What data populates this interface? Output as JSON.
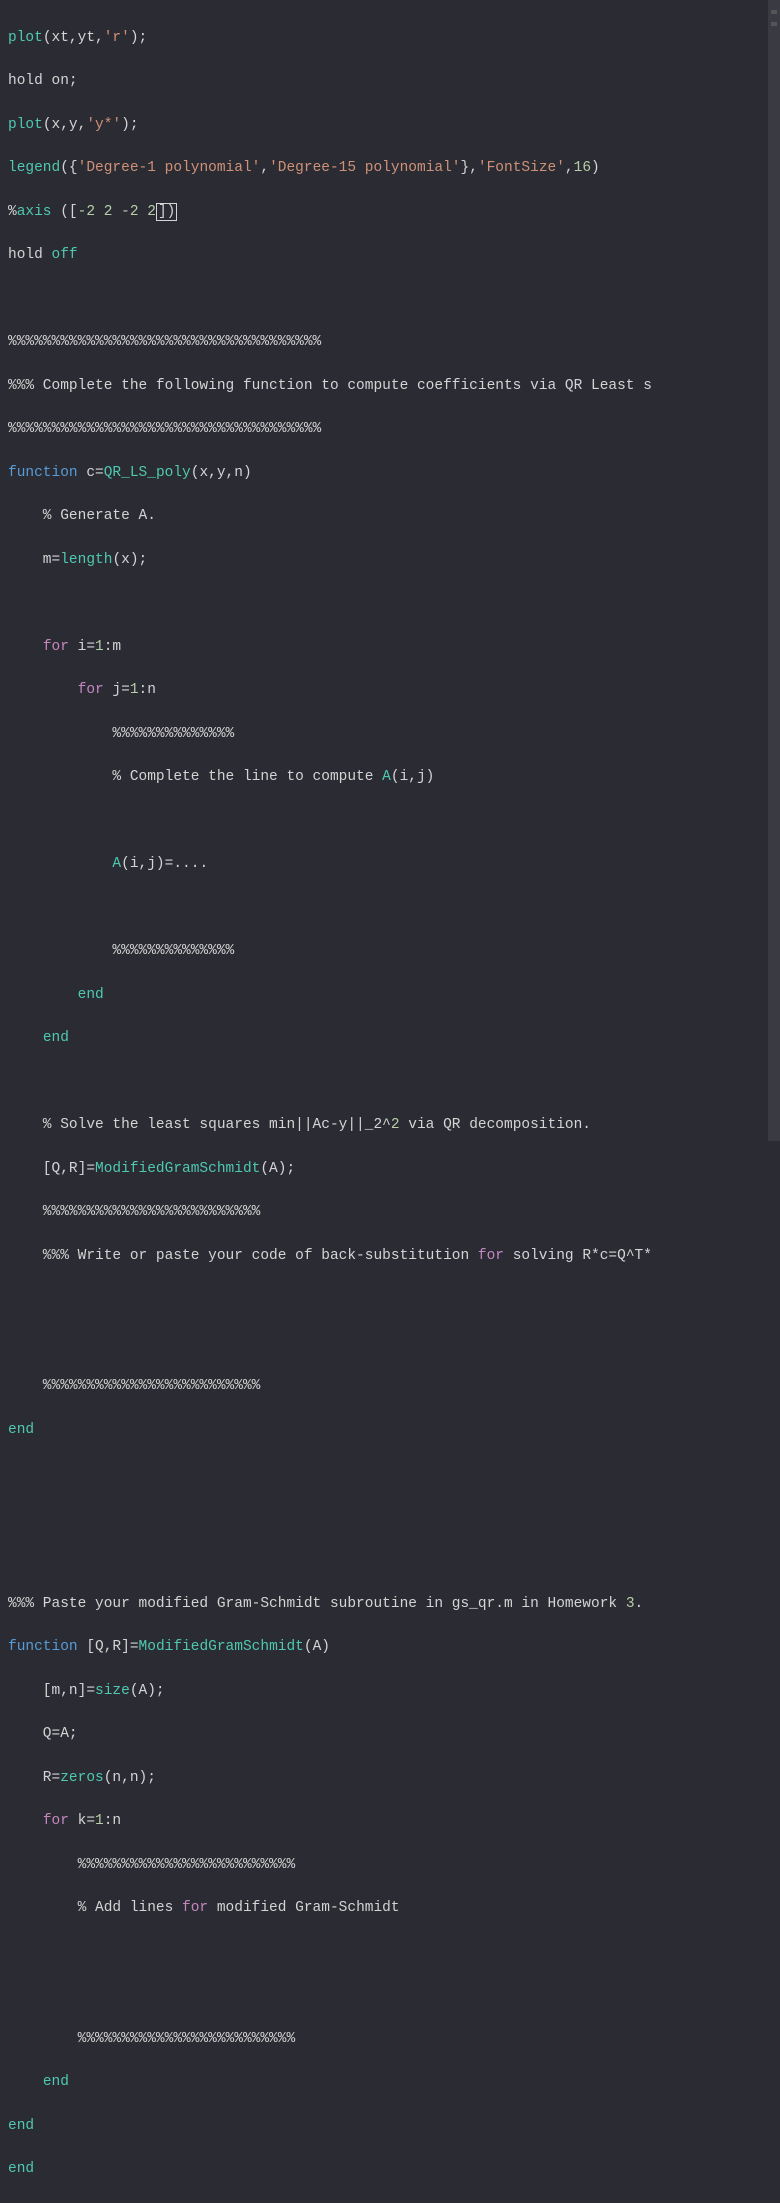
{
  "code": {
    "l1_a": "plot",
    "l1_b": "(xt,yt,",
    "l1_c": "'r'",
    "l1_d": ");",
    "l2": "hold on;",
    "l3_a": "plot",
    "l3_b": "(x,y,",
    "l3_c": "'y*'",
    "l3_d": ");",
    "l4_a": "legend",
    "l4_b": "({",
    "l4_c": "'Degree-1 polynomial'",
    "l4_d": ",",
    "l4_e": "'Degree-15 polynomial'",
    "l4_f": "},",
    "l4_g": "'FontSize'",
    "l4_h": ",",
    "l4_i": "16",
    "l4_j": ")",
    "l5_a": "%",
    "l5_b": "axis",
    "l5_c": " ([",
    "l5_d": "-2",
    "l5_e": " ",
    "l5_f": "2",
    "l5_g": " ",
    "l5_h": "-2",
    "l5_i": " ",
    "l5_j": "2",
    "l5_k": "])",
    "l6_a": "hold ",
    "l6_b": "off",
    "l8": "%%%%%%%%%%%%%%%%%%%%%%%%%%%%%%%%%%%%",
    "l9": "%%% Complete the following function to compute coefficients via QR Least s",
    "l10": "%%%%%%%%%%%%%%%%%%%%%%%%%%%%%%%%%%%%",
    "l11_a": "function",
    "l11_b": " c=",
    "l11_c": "QR_LS_poly",
    "l11_d": "(x,y,n)",
    "l12": "    % Generate A.",
    "l13_a": "    m=",
    "l13_b": "length",
    "l13_c": "(x);",
    "l15_a": "    ",
    "l15_b": "for",
    "l15_c": " i=",
    "l15_d": "1",
    "l15_e": ":m",
    "l16_a": "        ",
    "l16_b": "for",
    "l16_c": " j=",
    "l16_d": "1",
    "l16_e": ":n",
    "l17": "            %%%%%%%%%%%%%%",
    "l18_a": "            % Complete the line to compute ",
    "l18_b": "A",
    "l18_c": "(i,j)",
    "l20_a": "            ",
    "l20_b": "A",
    "l20_c": "(i,j)=....",
    "l22": "            %%%%%%%%%%%%%%",
    "l23_a": "        ",
    "l23_b": "end",
    "l24_a": "    ",
    "l24_b": "end",
    "l26": "    % Solve the least squares min||Ac-y||_2^2 via QR decomposition.",
    "l26_sup": "2",
    "l27_a": "    [Q,R]=",
    "l27_b": "ModifiedGramSchmidt",
    "l27_c": "(A);",
    "l28": "    %%%%%%%%%%%%%%%%%%%%%%%%%",
    "l29_a": "    %%% Write or paste your code of back-substitution ",
    "l29_b": "for",
    "l29_c": " solving R*c=Q^T*",
    "l32": "    %%%%%%%%%%%%%%%%%%%%%%%%%",
    "l33": "end",
    "l37_a": "%%% Paste your modified Gram-Schmidt subroutine in gs_qr.m in Homework ",
    "l37_b": "3",
    "l37_c": ".",
    "l38_a": "function",
    "l38_b": " [Q,R]=",
    "l38_c": "ModifiedGramSchmidt",
    "l38_d": "(A)",
    "l39_a": "    [m,n]=",
    "l39_b": "size",
    "l39_c": "(A);",
    "l40": "    Q=A;",
    "l41_a": "    R=",
    "l41_b": "zeros",
    "l41_c": "(n,n);",
    "l42_a": "    ",
    "l42_b": "for",
    "l42_c": " k=",
    "l42_d": "1",
    "l42_e": ":n",
    "l43": "        %%%%%%%%%%%%%%%%%%%%%%%%%",
    "l44_a": "        % Add lines ",
    "l44_b": "for",
    "l44_c": " modified Gram-Schmidt",
    "l47": "        %%%%%%%%%%%%%%%%%%%%%%%%%",
    "l48_a": "    ",
    "l48_b": "end",
    "l49": "end",
    "l50": "end"
  },
  "colors": {
    "bg": "#2b2b33",
    "text": "#d4d4d4",
    "keyword": "#569cd6",
    "func": "#4ec9b0",
    "string": "#ce9178",
    "number": "#b5cea8",
    "for": "#c586c0"
  }
}
